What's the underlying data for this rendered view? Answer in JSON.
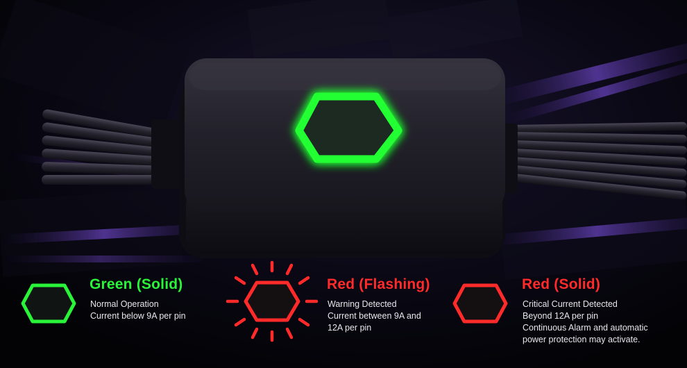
{
  "product": {
    "name": "cable safety indicator module",
    "glow_color": "#22ff33",
    "icon": "hexagon-logo-icon"
  },
  "colors": {
    "green": "#2af43a",
    "red": "#ff1f1f",
    "background": "#05040a",
    "purple_accent": "#5b3aa8"
  },
  "legend": [
    {
      "title": "Green (Solid)",
      "color": "#2af43a",
      "icon": "green-solid-hexagon-icon",
      "lines": [
        "Normal Operation",
        "Current below 9A per pin"
      ]
    },
    {
      "title": "Red (Flashing)",
      "color": "#ff2a2a",
      "icon": "red-flashing-hexagon-icon",
      "lines": [
        "Warning Detected",
        "Current between 9A and",
        "12A per pin"
      ]
    },
    {
      "title": "Red (Solid)",
      "color": "#ff2a2a",
      "icon": "red-solid-hexagon-icon",
      "lines": [
        "Critical Current Detected",
        "Beyond 12A per pin",
        "Continuous Alarm and automatic",
        "power protection may activate."
      ]
    }
  ]
}
